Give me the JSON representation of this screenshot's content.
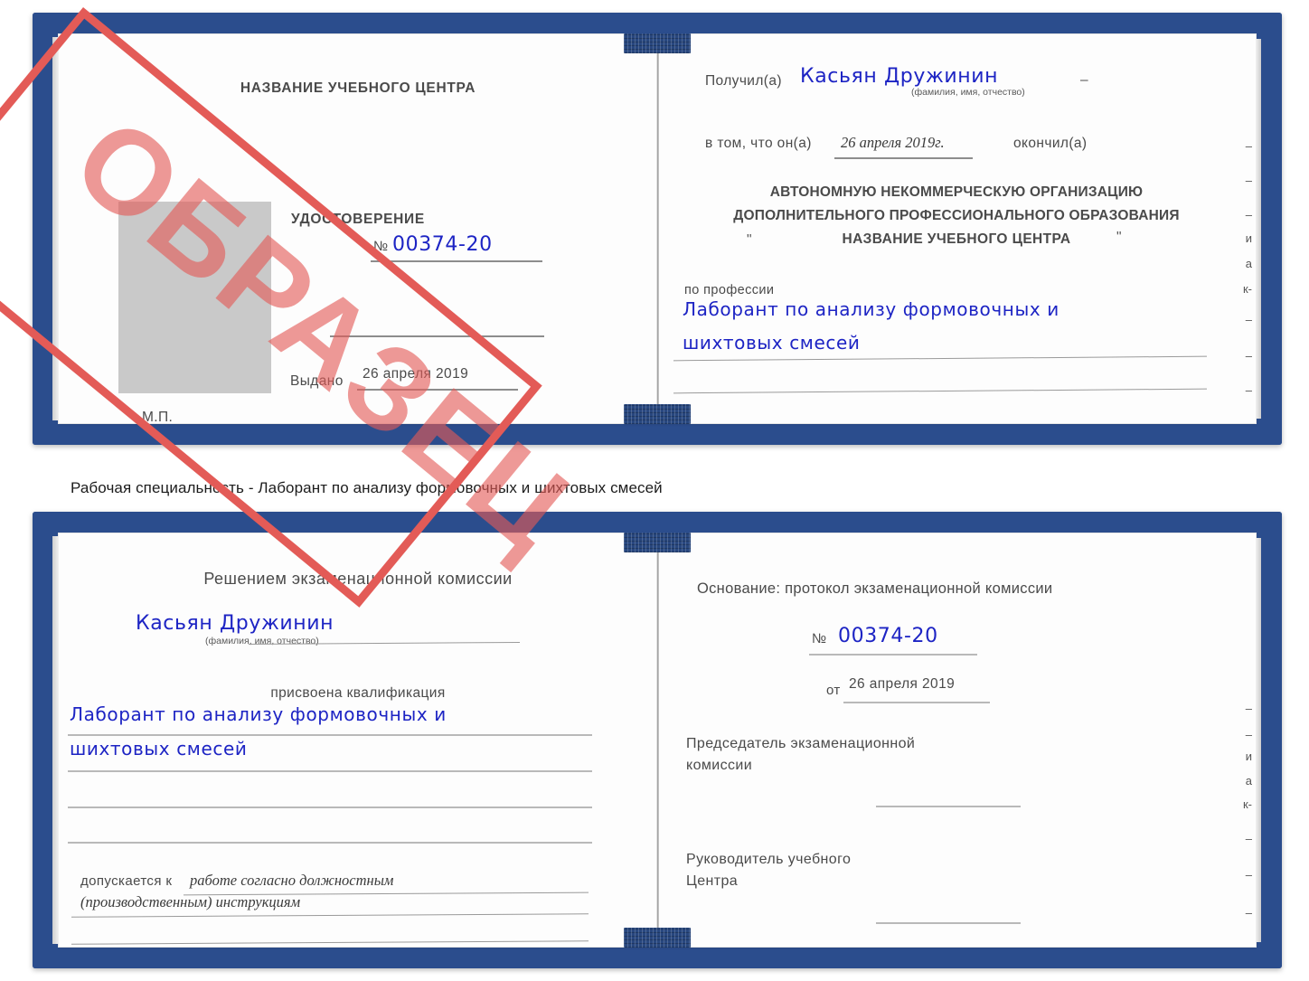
{
  "caption": "Рабочая специальность - Лаборант по анализу формовочных и шихтовых смесей",
  "stamp": {
    "label": "ОБРАЗЕЦ",
    "color": "#e35b57"
  },
  "colors": {
    "cover": "#2d4f90",
    "paper": "#fdfdfd",
    "handwriting": "#1d24c4",
    "rule": "#b9b9b9",
    "photo_placeholder": "#c9c9c9"
  },
  "certificate_top": {
    "left_page": {
      "center_name": "НАЗВАНИЕ УЧЕБНОГО ЦЕНТРА",
      "doc_type": "УДОСТОВЕРЕНИЕ",
      "number_label": "№",
      "number_value": "00374-20",
      "issued_label": "Выдано",
      "issued_value": "26 апреля 2019",
      "seal_label": "М.П.",
      "photo_placeholder": "photo-placeholder"
    },
    "right_page": {
      "received_label": "Получил(а)",
      "received_value": "Касьян Дружинин",
      "fio_hint": "(фамилия, имя, отчество)",
      "that_he_label": "в том, что он(а)",
      "completion_date": "26 апреля 2019г.",
      "finished_label": "окончил(а)",
      "org_line1": "АВТОНОМНУЮ НЕКОММЕРЧЕСКУЮ ОРГАНИЗАЦИЮ",
      "org_line2": "ДОПОЛНИТЕЛЬНОГО ПРОФЕССИОНАЛЬНОГО ОБРАЗОВАНИЯ",
      "quote_open": "\"",
      "org_name": "НАЗВАНИЕ УЧЕБНОГО ЦЕНТРА",
      "quote_close": "\"",
      "profession_label": "по профессии",
      "profession_line1": "Лаборант по анализу формовочных и",
      "profession_line2": "шихтовых смесей",
      "edge_fragments": [
        "–",
        "–",
        "–",
        "и",
        "а",
        "к-",
        "–",
        "–",
        "–"
      ]
    }
  },
  "certificate_bottom": {
    "left_page": {
      "decision_title": "Решением экзаменационной комиссии",
      "name_value": "Касьян Дружинин",
      "fio_hint": "(фамилия, имя, отчество)",
      "qualification_label": "присвоена квалификация",
      "qualification_line1": "Лаборант по анализу формовочных и",
      "qualification_line2": "шихтовых смесей",
      "admitted_label": "допускается к",
      "admitted_line1": "работе согласно должностным",
      "admitted_line2": "(производственным) инструкциям"
    },
    "right_page": {
      "basis_label": "Основание: протокол экзаменационной комиссии",
      "number_label": "№",
      "number_value": "00374-20",
      "date_label": "от",
      "date_value": "26 апреля 2019",
      "chairman_line1": "Председатель экзаменационной",
      "chairman_line2": "комиссии",
      "head_line1": "Руководитель учебного",
      "head_line2": "Центра",
      "edge_fragments": [
        "–",
        "–",
        "и",
        "а",
        "к-",
        "–",
        "–",
        "–"
      ]
    }
  }
}
